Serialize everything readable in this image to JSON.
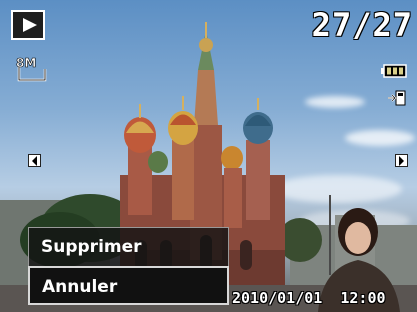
{
  "osd": {
    "file_counter": "27/27",
    "resolution_label": "8M",
    "timestamp": "2010/01/01  12:00"
  },
  "icons": {
    "mode": "play-icon",
    "resolution": "resolution-8m-icon",
    "battery": "battery-full-icon",
    "protect": "file-protect-icon",
    "prev": "chevron-left-icon",
    "next": "chevron-right-icon"
  },
  "menu": {
    "items": [
      {
        "label": "Supprimer"
      },
      {
        "label": "Annuler"
      }
    ],
    "selected": "Annuler"
  },
  "colors": {
    "osd_text": "#ffffff",
    "menu_bg": "#111111",
    "selected_border": "#d8d8d8"
  }
}
